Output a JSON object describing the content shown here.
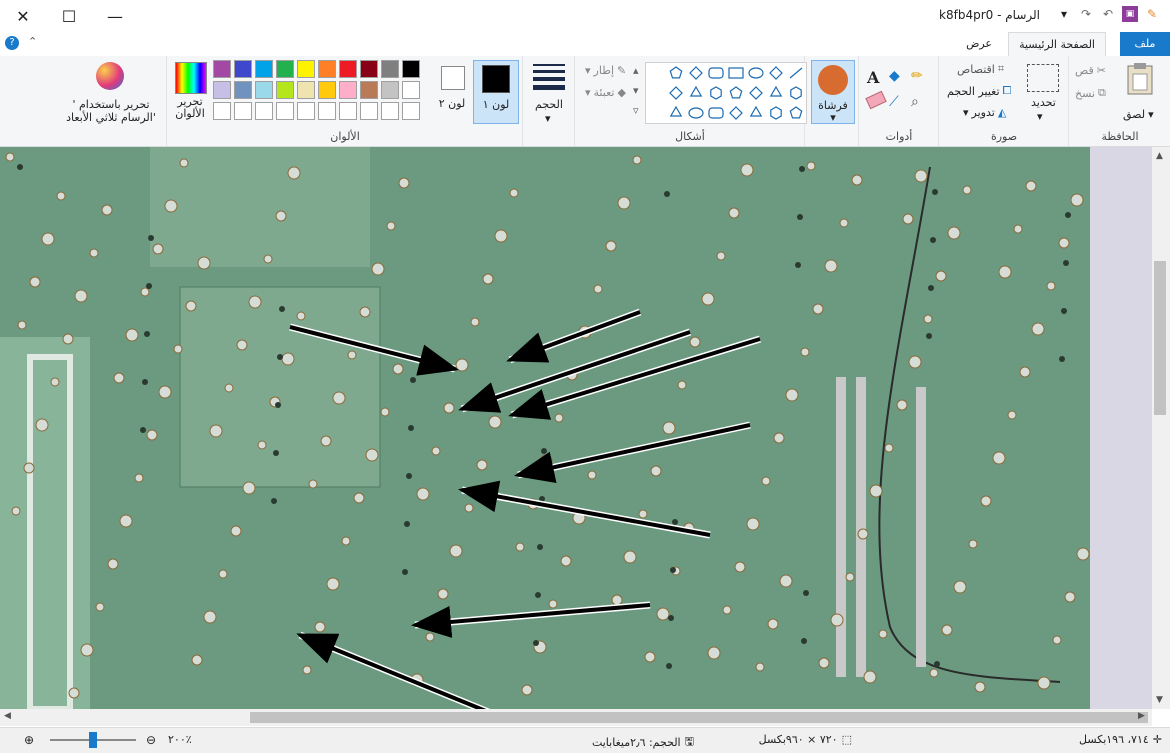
{
  "window": {
    "title": "k8fb4pr0 - الرسام"
  },
  "tabs": {
    "file": "ملف",
    "home": "الصفحة الرئيسية",
    "view": "عرض"
  },
  "clipboard": {
    "label": "الحافظة",
    "paste": "لصق",
    "cut": "قص",
    "copy": "نسخ"
  },
  "image": {
    "label": "صورة",
    "select": "تحديد",
    "crop": "اقتصاص",
    "resize": "تغيير الحجم",
    "rotate": "تدوير"
  },
  "tools": {
    "label": "أدوات"
  },
  "brushes": {
    "label": "فرشاة"
  },
  "shapes": {
    "label": "أشكال",
    "outline": "إطار",
    "fill": "تعبئة"
  },
  "size": {
    "label": "الحجم"
  },
  "colors": {
    "label": "الألوان",
    "color1": "لون ١",
    "color2": "لون ٢",
    "color1_value": "#000000",
    "color2_value": "#ffffff",
    "edit_colors": "تحرير الألوان",
    "paint3d": "تحرير باستخدام ' الرسام ثلاثي الأبعاد'",
    "palette_row1": [
      "#000000",
      "#7f7f7f",
      "#880015",
      "#ed1c24",
      "#ff7f27",
      "#fff200",
      "#22b14c",
      "#00a2e8",
      "#3f48cc",
      "#a349a4"
    ],
    "palette_row2": [
      "#ffffff",
      "#c3c3c3",
      "#b97a57",
      "#ffaec9",
      "#ffc90e",
      "#efe4b0",
      "#b5e61d",
      "#99d9ea",
      "#7092be",
      "#c8bfe7"
    ]
  },
  "status": {
    "cursor_pos": "٧١٤، ١٩٦بكسل",
    "image_size": "٧٢٠ × ٩٦٠بكسل",
    "file_size": "الحجم: ٢٫٦ميغابايت",
    "zoom": "٢٠٠٪",
    "zoom_level": 0.5
  },
  "annotations": {
    "arrows": 9
  }
}
